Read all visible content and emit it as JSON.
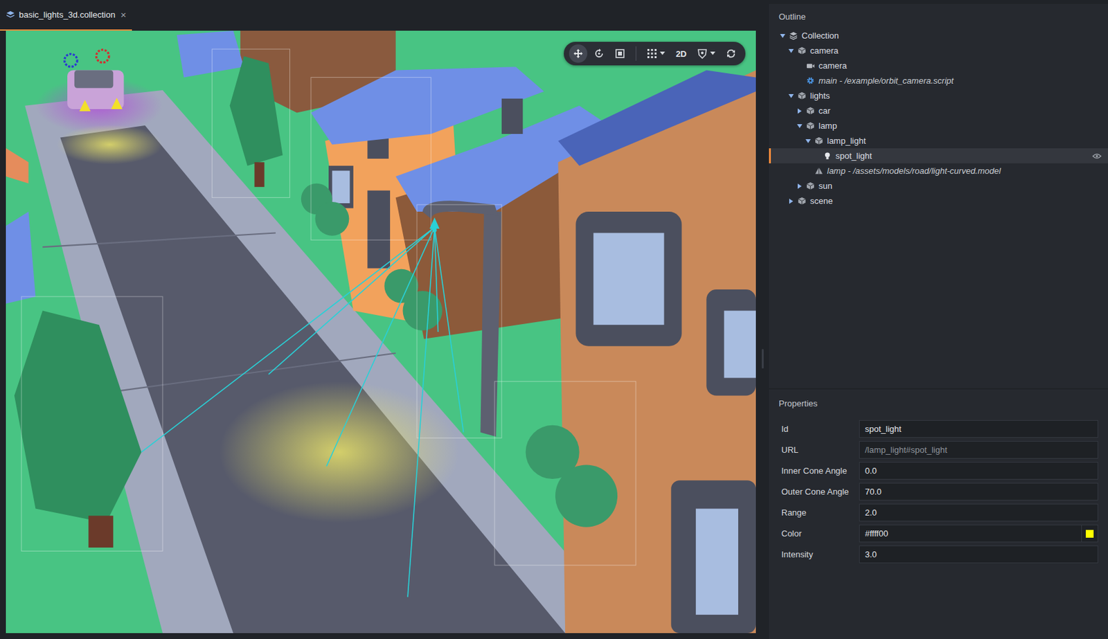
{
  "tab": {
    "label": "basic_lights_3d.collection",
    "close": "×",
    "selected": true
  },
  "toolbar": {
    "tools": [
      {
        "kind": "move",
        "group": 1,
        "selected": true,
        "dropdown": false,
        "label": ""
      },
      {
        "kind": "rotate",
        "group": 1,
        "selected": false,
        "dropdown": false,
        "label": ""
      },
      {
        "kind": "scale",
        "group": 1,
        "selected": false,
        "dropdown": false,
        "label": ""
      },
      {
        "kind": "grid",
        "group": 2,
        "selected": false,
        "dropdown": true,
        "label": ""
      },
      {
        "kind": "mode-2d",
        "group": 2,
        "selected": false,
        "dropdown": false,
        "label": "2D"
      },
      {
        "kind": "visibility",
        "group": 2,
        "selected": false,
        "dropdown": true,
        "label": ""
      },
      {
        "kind": "reset-camera",
        "group": 2,
        "selected": false,
        "dropdown": false,
        "label": ""
      }
    ]
  },
  "outline": {
    "title": "Outline",
    "items": [
      {
        "label": "Collection",
        "kind": "collection",
        "depth": 0,
        "has_children": true,
        "expanded": true,
        "selected": false,
        "eye": false
      },
      {
        "label": "camera",
        "kind": "gameobject",
        "depth": 1,
        "has_children": true,
        "expanded": true,
        "selected": false,
        "eye": false
      },
      {
        "label": "camera",
        "kind": "camera",
        "depth": 2,
        "has_children": false,
        "expanded": false,
        "selected": false,
        "eye": false
      },
      {
        "label": "main - /example/orbit_camera.script",
        "kind": "script",
        "depth": 2,
        "has_children": false,
        "expanded": false,
        "selected": false,
        "eye": false
      },
      {
        "label": "lights",
        "kind": "gameobject",
        "depth": 1,
        "has_children": true,
        "expanded": true,
        "selected": false,
        "eye": false
      },
      {
        "label": "car",
        "kind": "gameobject",
        "depth": 2,
        "has_children": true,
        "expanded": false,
        "selected": false,
        "eye": false
      },
      {
        "label": "lamp",
        "kind": "gameobject",
        "depth": 2,
        "has_children": true,
        "expanded": true,
        "selected": false,
        "eye": false
      },
      {
        "label": "lamp_light",
        "kind": "gameobject",
        "depth": 3,
        "has_children": true,
        "expanded": true,
        "selected": false,
        "eye": false
      },
      {
        "label": "spot_light",
        "kind": "light",
        "depth": 4,
        "has_children": false,
        "expanded": false,
        "selected": true,
        "eye": true
      },
      {
        "label": "lamp - /assets/models/road/light-curved.model",
        "kind": "model",
        "depth": 3,
        "has_children": false,
        "expanded": false,
        "selected": false,
        "eye": false
      },
      {
        "label": "sun",
        "kind": "gameobject",
        "depth": 2,
        "has_children": true,
        "expanded": false,
        "selected": false,
        "eye": false
      },
      {
        "label": "scene",
        "kind": "gameobject",
        "depth": 1,
        "has_children": true,
        "expanded": false,
        "selected": false,
        "eye": false
      }
    ]
  },
  "properties": {
    "title": "Properties",
    "rows": [
      {
        "label": "Id",
        "value": "spot_light",
        "kind": "text"
      },
      {
        "label": "URL",
        "value": "/lamp_light#spot_light",
        "kind": "readonly"
      },
      {
        "label": "Inner Cone Angle",
        "value": "0.0",
        "kind": "text"
      },
      {
        "label": "Outer Cone Angle",
        "value": "70.0",
        "kind": "text"
      },
      {
        "label": "Range",
        "value": "2.0",
        "kind": "text"
      },
      {
        "label": "Color",
        "value": "#ffff00",
        "kind": "color"
      },
      {
        "label": "Intensity",
        "value": "3.0",
        "kind": "text"
      }
    ]
  }
}
